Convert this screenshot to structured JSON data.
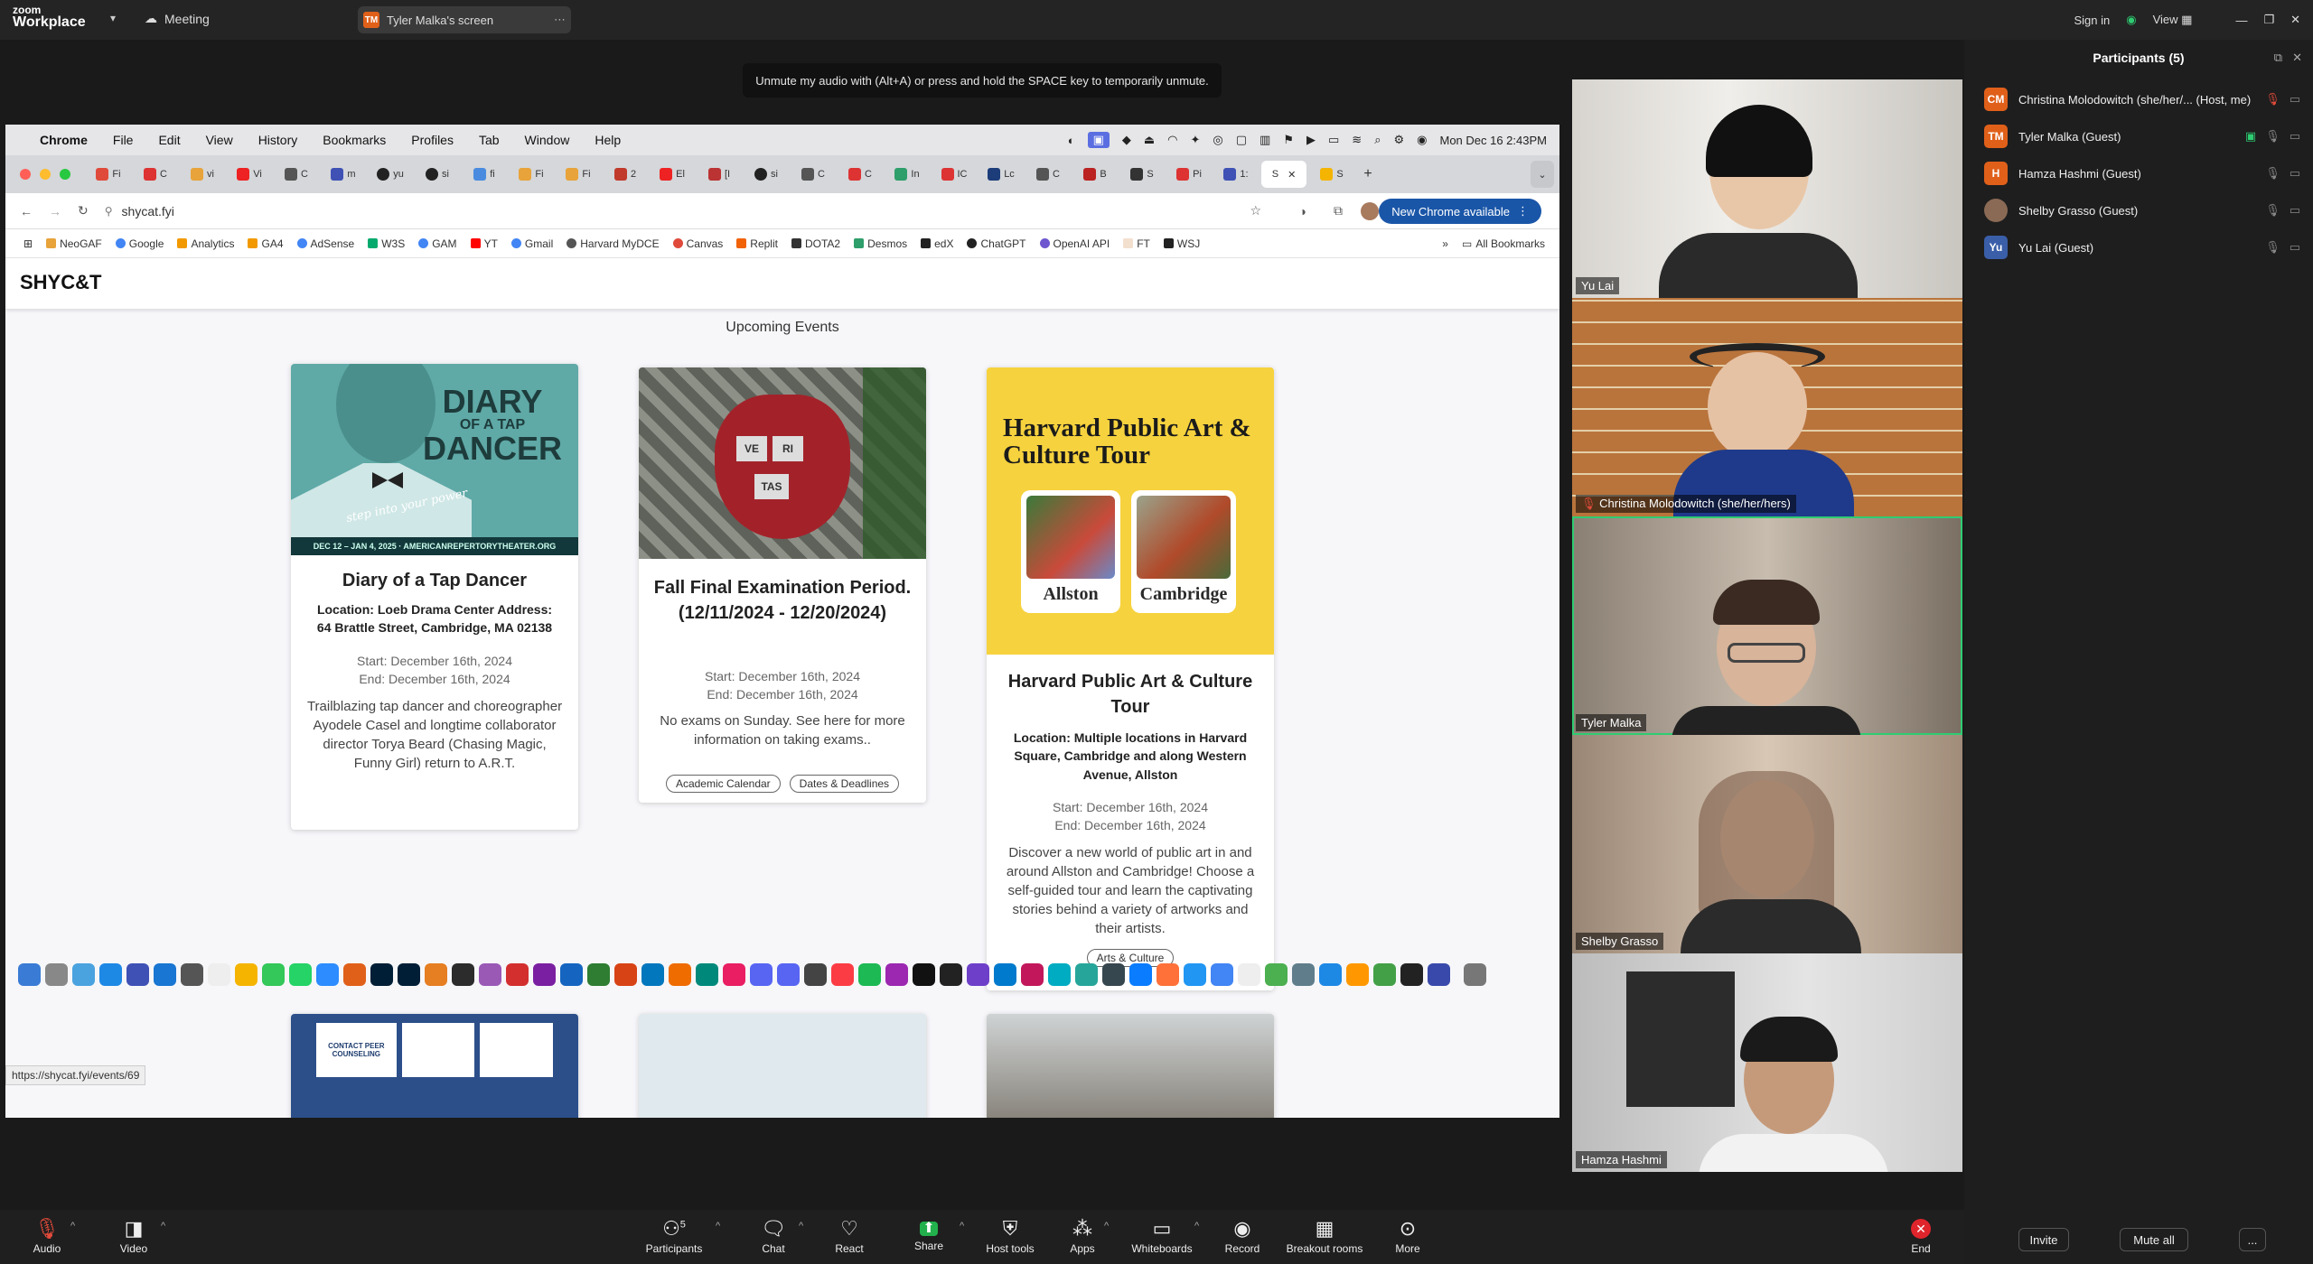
{
  "zoom": {
    "logo_line1": "zoom",
    "logo_line2": "Workplace",
    "meeting_label": "Meeting",
    "screen_pill": {
      "initial": "TM",
      "label": "Tyler Malka's screen"
    },
    "top_right": {
      "sign_in": "Sign in",
      "view": "View"
    },
    "toast": "Unmute my audio with (Alt+A) or press and hold the SPACE key to temporarily unmute."
  },
  "mac": {
    "app": "Chrome",
    "menus": [
      "File",
      "Edit",
      "View",
      "History",
      "Bookmarks",
      "Profiles",
      "Tab",
      "Window",
      "Help"
    ],
    "clock": "Mon Dec 16  2:43PM"
  },
  "browser": {
    "url": "shycat.fyi",
    "new_chrome": "New Chrome available",
    "tabs": [
      "Fi",
      "C",
      "vi",
      "Vi",
      "C",
      "m",
      "yu",
      "si",
      "fi",
      "Fi",
      "Fi",
      "2",
      "El",
      "[I",
      "si",
      "C",
      "C",
      "In",
      "IC",
      "Lc",
      "C",
      "B",
      "S",
      "Pi",
      "1:",
      "S",
      "S"
    ],
    "bookmarks": [
      "NeoGAF",
      "Google",
      "Analytics",
      "GA4",
      "AdSense",
      "W3S",
      "GAM",
      "YT",
      "Gmail",
      "Harvard MyDCE",
      "Canvas",
      "Replit",
      "DOTA2",
      "Desmos",
      "edX",
      "ChatGPT",
      "OpenAI API",
      "FT",
      "WSJ"
    ],
    "all_bookmarks": "All Bookmarks",
    "status_url": "https://shycat.fyi/events/69"
  },
  "site": {
    "brand": "SHYC&T",
    "section_title": "Upcoming Events",
    "cards": [
      {
        "image_text": {
          "t1": "DIARY",
          "t2": "OF A TAP",
          "t3": "DANCER",
          "banner": "DEC 12 – JAN 4, 2025 · AMERICANREPERTORYTHEATER.ORG",
          "script": "step into your power"
        },
        "title": "Diary of a Tap Dancer",
        "location": "Location: Loeb Drama Center Address: 64 Brattle Street, Cambridge, MA 02138",
        "start": "Start: December 16th, 2024",
        "end": "End: December 16th, 2024",
        "desc": "Trailblazing tap dancer and choreographer Ayodele Casel and longtime collaborator director Torya Beard (Chasing Magic, Funny Girl) return to A.R.T.",
        "tags": []
      },
      {
        "image_text": {
          "ve": "VE",
          "ri": "RI",
          "tas": "TAS"
        },
        "title": "Fall Final Examination Period. (12/11/2024 - 12/20/2024)",
        "location": "",
        "start": "Start: December 16th, 2024",
        "end": "End: December 16th, 2024",
        "desc": "No exams on Sunday. See here for more information on taking exams..",
        "tags": [
          "Academic Calendar",
          "Dates & Deadlines"
        ]
      },
      {
        "image_text": {
          "headline": "Harvard Public Art & Culture Tour",
          "left": "Allston",
          "right": "Cambridge"
        },
        "title": "Harvard Public Art & Culture Tour",
        "location": "Location: Multiple locations in Harvard Square, Cambridge and along Western Avenue, Allston",
        "start": "Start: December 16th, 2024",
        "end": "End: December 16th, 2024",
        "desc": "Discover a new world of public art in and around Allston and Cambridge! Choose a self-guided tour and learn the captivating stories behind a variety of artworks and their artists.",
        "tags": [
          "Arts & Culture"
        ]
      }
    ],
    "next_row_text": "CONTACT PEER COUNSELING"
  },
  "gallery": [
    "Yu Lai",
    "Christina Molodowitch (she/her/hers)",
    "Tyler Malka",
    "Shelby Grasso",
    "Hamza Hashmi"
  ],
  "participants": {
    "title": "Participants (5)",
    "list": [
      {
        "initials": "CM",
        "name": "Christina Molodowitch (she/her/... (Host, me)",
        "color": "#e0601a"
      },
      {
        "initials": "TM",
        "name": "Tyler Malka (Guest)",
        "color": "#e0601a"
      },
      {
        "initials": "H",
        "name": "Hamza Hashmi (Guest)",
        "color": "#e0601a"
      },
      {
        "initials": "",
        "name": "Shelby Grasso (Guest)",
        "color": "#8a6a55"
      },
      {
        "initials": "Yu",
        "name": "Yu Lai (Guest)",
        "color": "#3a5ea8"
      }
    ],
    "invite": "Invite",
    "mute_all": "Mute all",
    "more": "..."
  },
  "toolbar": {
    "audio": "Audio",
    "video": "Video",
    "participants": "Participants",
    "participants_count": "5",
    "chat": "Chat",
    "react": "React",
    "share": "Share",
    "host_tools": "Host tools",
    "apps": "Apps",
    "whiteboards": "Whiteboards",
    "record": "Record",
    "breakout": "Breakout rooms",
    "more": "More",
    "end": "End"
  }
}
